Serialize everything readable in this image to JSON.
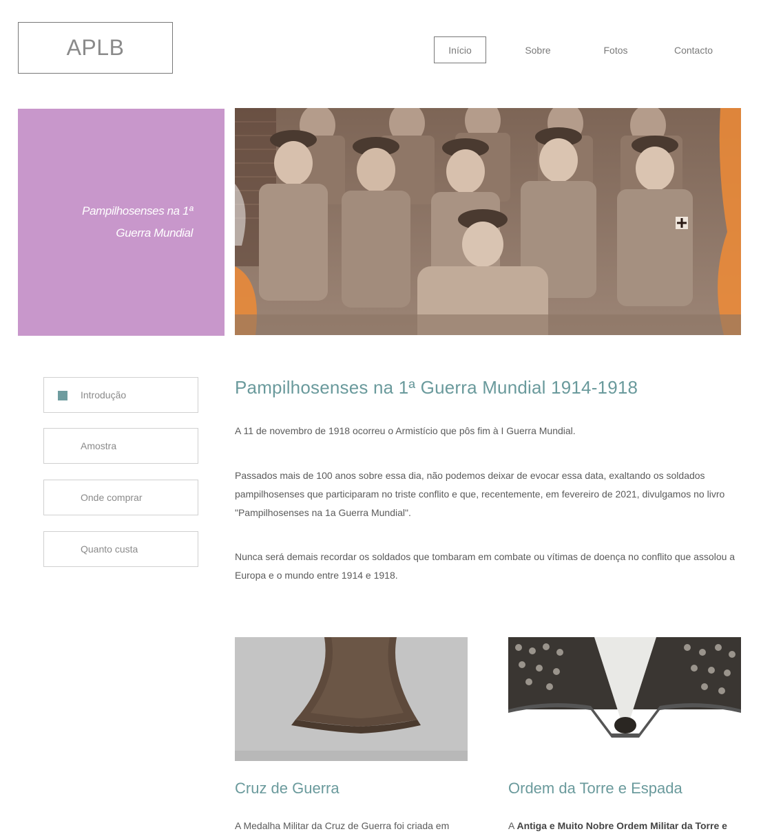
{
  "header": {
    "logo_text": "APLB",
    "nav": [
      {
        "label": "Início",
        "active": true
      },
      {
        "label": "Sobre",
        "active": false
      },
      {
        "label": "Fotos",
        "active": false
      },
      {
        "label": "Contacto",
        "active": false
      }
    ]
  },
  "hero": {
    "caption_line1": "Pampilhosenses na 1ª",
    "caption_line2": "Guerra Mundial",
    "panel_color": "#c897cb"
  },
  "sidebar": {
    "items": [
      {
        "label": "Introdução",
        "active": true
      },
      {
        "label": "Amostra",
        "active": false
      },
      {
        "label": "Onde comprar",
        "active": false
      },
      {
        "label": "Quanto custa",
        "active": false
      }
    ],
    "marker_color": "#6e9c9f"
  },
  "main": {
    "title": "Pampilhosenses na 1ª Guerra Mundial 1914-1918",
    "paragraphs": [
      "A 11 de novembro de 1918 ocorreu o Armistício que pôs fim à I Guerra Mundial.",
      "Passados mais de 100 anos sobre essa dia, não podemos deixar de evocar essa data, exaltando os soldados pampilhosenses que participaram no triste conflito e que, recentemente, em fevereiro de 2021, divulgamos no livro \"Pampilhosenses na 1a Guerra Mundial\".",
      "Nunca será demais recordar os soldados que tombaram em combate ou vítimas de doença no conflito que assolou a Europa e o mundo entre 1914 e 1918."
    ]
  },
  "cards": [
    {
      "title": "Cruz de Guerra",
      "text": "A Medalha Militar da Cruz de Guerra foi criada em"
    },
    {
      "title": "Ordem da Torre e Espada",
      "text_prefix": "A ",
      "text_bold": "Antiga e Muito Nobre Ordem Militar da Torre e"
    }
  ],
  "colors": {
    "accent": "#6a9a9c",
    "text": "#5a5a5a",
    "border": "#d0d0d0"
  }
}
